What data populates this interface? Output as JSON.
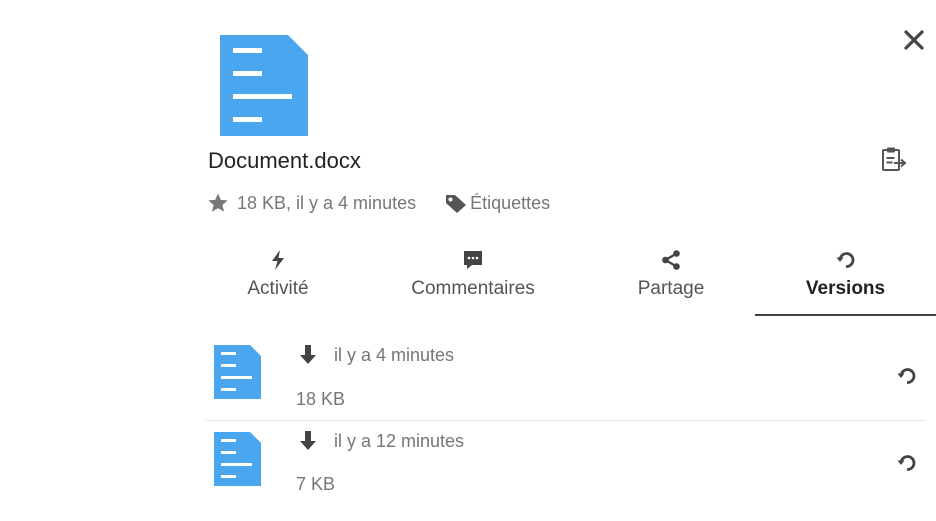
{
  "file": {
    "name": "Document.docx",
    "meta": "18 KB, il y a 4 minutes",
    "tags_label": "Étiquettes"
  },
  "icons": {
    "close": "close-icon",
    "file": "document-icon",
    "clipboard": "clipboard-icon",
    "favorite": "star-icon",
    "tags": "tag-icon",
    "download": "download-arrow-icon",
    "restore": "restore-icon"
  },
  "tabs": [
    {
      "label": "Activité",
      "icon": "lightning-icon"
    },
    {
      "label": "Commentaires",
      "icon": "comment-icon"
    },
    {
      "label": "Partage",
      "icon": "share-icon"
    },
    {
      "label": "Versions",
      "icon": "history-icon",
      "active": true
    }
  ],
  "versions": [
    {
      "time": "il y a 4 minutes",
      "size": "18 KB"
    },
    {
      "time": "il y a 12 minutes",
      "size": "7 KB"
    }
  ],
  "colors": {
    "file_icon": "#4aa6ef",
    "icon_gray": "#444444",
    "muted_text": "#767676"
  }
}
